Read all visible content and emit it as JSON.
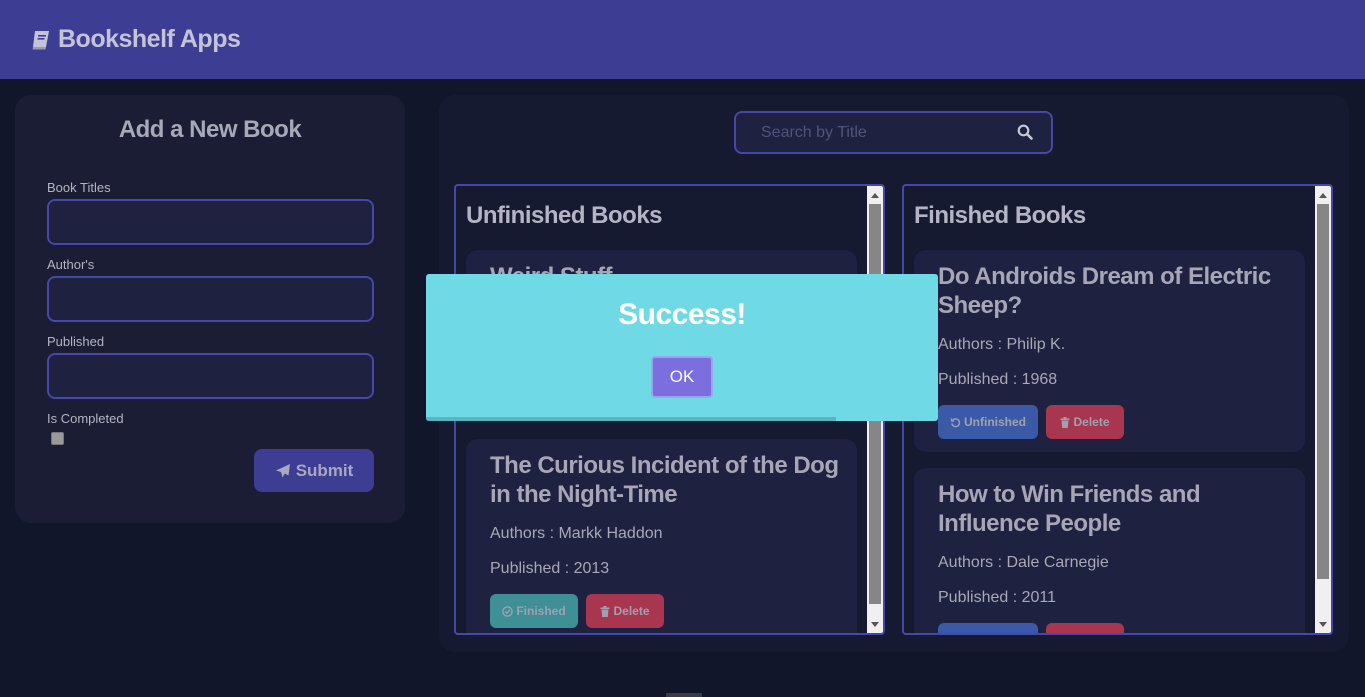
{
  "app": {
    "title": "Bookshelf Apps"
  },
  "form": {
    "title": "Add a New Book",
    "title_label": "Book Titles",
    "author_label": "Author's",
    "published_label": "Published",
    "completed_label": "Is Completed",
    "submit_label": "Submit"
  },
  "search": {
    "placeholder": "Search by Title"
  },
  "unfinished": {
    "heading": "Unfinished Books",
    "books": [
      {
        "title": "Weird Stuff"
      },
      {
        "title": "The Curious Incident of the Dog in the Night-Time",
        "authors": "Authors : Markk Haddon",
        "published": "Published : 2013",
        "toggle_label": "Finished",
        "delete_label": "Delete"
      }
    ]
  },
  "finished": {
    "heading": "Finished Books",
    "books": [
      {
        "title": "Do Androids Dream of Electric Sheep?",
        "authors": "Authors : Philip K.",
        "published": "Published : 1968",
        "toggle_label": "Unfinished",
        "delete_label": "Delete"
      },
      {
        "title": "How to Win Friends and Influence People",
        "authors": "Authors : Dale Carnegie",
        "published": "Published : 2011"
      }
    ]
  },
  "modal": {
    "title": "Success!",
    "ok_label": "OK",
    "timer_progress": 0.8
  },
  "colors": {
    "navbar": "#3d3d94",
    "background": "#12162b",
    "accent_border": "#4747a8",
    "finished_btn": "#3f8f96",
    "unfinished_btn": "#3a5aa8",
    "delete_btn": "#a8364f",
    "modal_bg": "#6fd9e6",
    "modal_btn": "#7b6fe0"
  }
}
